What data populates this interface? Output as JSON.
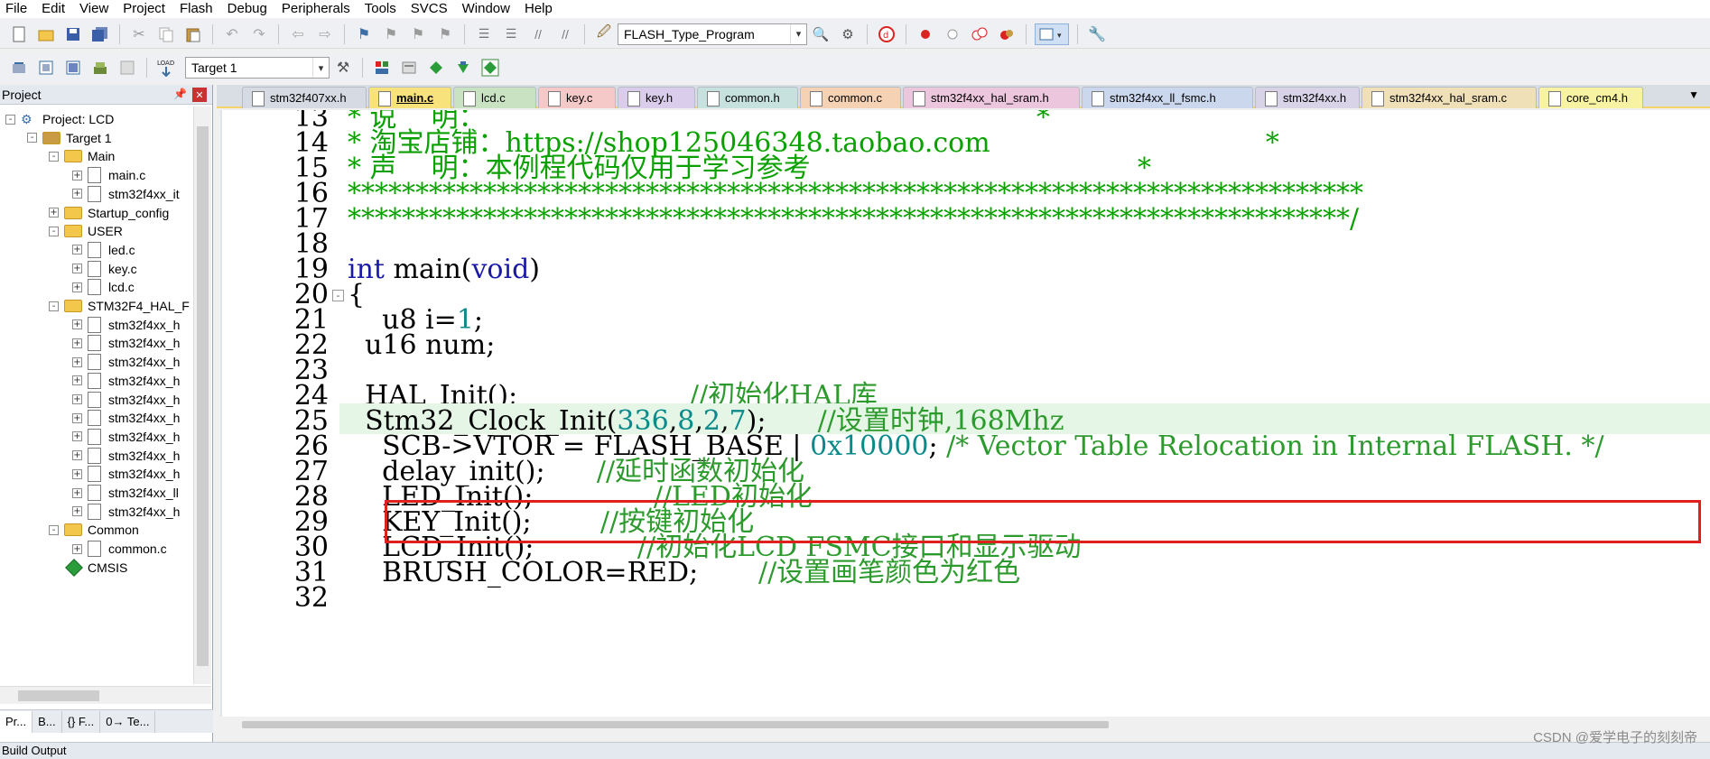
{
  "menu": [
    "File",
    "Edit",
    "View",
    "Project",
    "Flash",
    "Debug",
    "Peripherals",
    "Tools",
    "SVCS",
    "Window",
    "Help"
  ],
  "toolbar": {
    "target_combo": "FLASH_Type_Program",
    "target_select": "Target 1"
  },
  "project_panel": {
    "title": "Project",
    "tree": [
      {
        "label": "Project: LCD",
        "kind": "project",
        "depth": 0,
        "expander": "-"
      },
      {
        "label": "Target 1",
        "kind": "target",
        "depth": 1,
        "expander": "-"
      },
      {
        "label": "Main",
        "kind": "folder",
        "depth": 2,
        "expander": "-"
      },
      {
        "label": "main.c",
        "kind": "file",
        "depth": 3,
        "expander": "+"
      },
      {
        "label": "stm32f4xx_it",
        "kind": "file",
        "depth": 3,
        "expander": "+"
      },
      {
        "label": "Startup_config",
        "kind": "folder",
        "depth": 2,
        "expander": "+"
      },
      {
        "label": "USER",
        "kind": "folder",
        "depth": 2,
        "expander": "-"
      },
      {
        "label": "led.c",
        "kind": "file",
        "depth": 3,
        "expander": "+"
      },
      {
        "label": "key.c",
        "kind": "file",
        "depth": 3,
        "expander": "+"
      },
      {
        "label": "lcd.c",
        "kind": "file",
        "depth": 3,
        "expander": "+"
      },
      {
        "label": "STM32F4_HAL_F",
        "kind": "folder",
        "depth": 2,
        "expander": "-"
      },
      {
        "label": "stm32f4xx_h",
        "kind": "file",
        "depth": 3,
        "expander": "+"
      },
      {
        "label": "stm32f4xx_h",
        "kind": "file",
        "depth": 3,
        "expander": "+"
      },
      {
        "label": "stm32f4xx_h",
        "kind": "file",
        "depth": 3,
        "expander": "+"
      },
      {
        "label": "stm32f4xx_h",
        "kind": "file",
        "depth": 3,
        "expander": "+"
      },
      {
        "label": "stm32f4xx_h",
        "kind": "file",
        "depth": 3,
        "expander": "+"
      },
      {
        "label": "stm32f4xx_h",
        "kind": "file",
        "depth": 3,
        "expander": "+"
      },
      {
        "label": "stm32f4xx_h",
        "kind": "file",
        "depth": 3,
        "expander": "+"
      },
      {
        "label": "stm32f4xx_h",
        "kind": "file",
        "depth": 3,
        "expander": "+"
      },
      {
        "label": "stm32f4xx_h",
        "kind": "file",
        "depth": 3,
        "expander": "+"
      },
      {
        "label": "stm32f4xx_ll",
        "kind": "file",
        "depth": 3,
        "expander": "+"
      },
      {
        "label": "stm32f4xx_h",
        "kind": "file",
        "depth": 3,
        "expander": "+"
      },
      {
        "label": "Common",
        "kind": "folder",
        "depth": 2,
        "expander": "-"
      },
      {
        "label": "common.c",
        "kind": "file",
        "depth": 3,
        "expander": "+"
      },
      {
        "label": "CMSIS",
        "kind": "component",
        "depth": 2,
        "expander": ""
      }
    ],
    "bottom_tabs": [
      "Pr...",
      "B...",
      "{} F...",
      "0→ Te..."
    ]
  },
  "editor_tabs": [
    {
      "label": "stm32f407xx.h",
      "color": "#d6dbe3",
      "active": false
    },
    {
      "label": "main.c",
      "color": "#f7e27c",
      "active": true
    },
    {
      "label": "lcd.c",
      "color": "#c9e3c2",
      "active": false
    },
    {
      "label": "key.c",
      "color": "#f6c9c9",
      "active": false
    },
    {
      "label": "key.h",
      "color": "#d9cdeb",
      "active": false
    },
    {
      "label": "common.h",
      "color": "#c6e1de",
      "active": false
    },
    {
      "label": "common.c",
      "color": "#f6d2b4",
      "active": false
    },
    {
      "label": "stm32f4xx_hal_sram.h",
      "color": "#ecc6dd",
      "active": false
    },
    {
      "label": "stm32f4xx_ll_fsmc.h",
      "color": "#cbd7ec",
      "active": false
    },
    {
      "label": "stm32f4xx.h",
      "color": "#d9d3e8",
      "active": false
    },
    {
      "label": "stm32f4xx_hal_sram.c",
      "color": "#efe0b8",
      "active": false
    },
    {
      "label": "core_cm4.h",
      "color": "#f7f3a3",
      "active": false
    }
  ],
  "code_lines": [
    {
      "n": "13",
      "segs": [
        [
          "* 说    明：",
          "c-green"
        ],
        [
          "                                                                *",
          "c-green"
        ]
      ]
    },
    {
      "n": "14",
      "segs": [
        [
          "* 淘宝店铺：https://shop125046348.taobao.com",
          "c-green"
        ],
        [
          "                                *",
          "c-green"
        ]
      ]
    },
    {
      "n": "15",
      "segs": [
        [
          "* 声    明：本例程代码仅用于学习参考",
          "c-green"
        ],
        [
          "                                      *",
          "c-green"
        ]
      ]
    },
    {
      "n": "16",
      "segs": [
        [
          "***************************************************************************",
          "c-stars"
        ]
      ]
    },
    {
      "n": "17",
      "segs": [
        [
          "**************************************************************************/",
          "c-stars"
        ]
      ]
    },
    {
      "n": "18",
      "segs": []
    },
    {
      "n": "19",
      "segs": [
        [
          "int",
          "c-kw"
        ],
        [
          " main(",
          ""
        ],
        [
          "void",
          "c-kw"
        ],
        [
          ")",
          ""
        ]
      ]
    },
    {
      "n": "20",
      "segs": [
        [
          "{",
          ""
        ]
      ],
      "fold": "-"
    },
    {
      "n": "21",
      "segs": [
        [
          "    u8 i=",
          ""
        ],
        [
          "1",
          "c-num"
        ],
        [
          ";",
          ""
        ]
      ]
    },
    {
      "n": "22",
      "segs": [
        [
          "  u16 num;",
          ""
        ]
      ]
    },
    {
      "n": "23",
      "segs": []
    },
    {
      "n": "24",
      "segs": [
        [
          "  HAL_Init();",
          ""
        ],
        [
          "                    //初始化HAL库",
          "c-comment"
        ]
      ]
    },
    {
      "n": "25",
      "segs": [
        [
          "  Stm32_Clock_Init(",
          ""
        ],
        [
          "336",
          "c-num"
        ],
        [
          ",",
          ""
        ],
        [
          "8",
          "c-num"
        ],
        [
          ",",
          ""
        ],
        [
          "2",
          "c-num"
        ],
        [
          ",",
          ""
        ],
        [
          "7",
          "c-num"
        ],
        [
          ");",
          ""
        ],
        [
          "      //设置时钟,168Mhz",
          "c-comment"
        ]
      ],
      "highlight": true
    },
    {
      "n": "26",
      "segs": [
        [
          "    SCB->VTOR = FLASH_BASE | ",
          ""
        ],
        [
          "0x10000",
          "c-num"
        ],
        [
          "; ",
          ""
        ],
        [
          "/* Vector Table Relocation in Internal FLASH. */",
          "c-comment"
        ]
      ]
    },
    {
      "n": "27",
      "segs": [
        [
          "    delay_init();",
          ""
        ],
        [
          "      //延时函数初始化",
          "c-comment"
        ]
      ]
    },
    {
      "n": "28",
      "segs": [
        [
          "    LED_Init();",
          ""
        ],
        [
          "              //LED初始化",
          "c-comment"
        ]
      ]
    },
    {
      "n": "29",
      "segs": [
        [
          "    KEY_Init();",
          ""
        ],
        [
          "        //按键初始化",
          "c-comment"
        ]
      ]
    },
    {
      "n": "30",
      "segs": [
        [
          "    LCD_Init();",
          ""
        ],
        [
          "            //初始化LCD FSMC接口和显示驱动",
          "c-comment"
        ]
      ]
    },
    {
      "n": "31",
      "segs": [
        [
          "    BRUSH_COLOR=RED;",
          ""
        ],
        [
          "       //设置画笔颜色为红色",
          "c-comment"
        ]
      ]
    },
    {
      "n": "32",
      "segs": []
    }
  ],
  "build_output": "Build Output",
  "watermark": "CSDN @爱学电子的刻刻帝",
  "accent": {
    "highlight_box": "#e0201c",
    "line_highlight": "#e6f6e6"
  }
}
